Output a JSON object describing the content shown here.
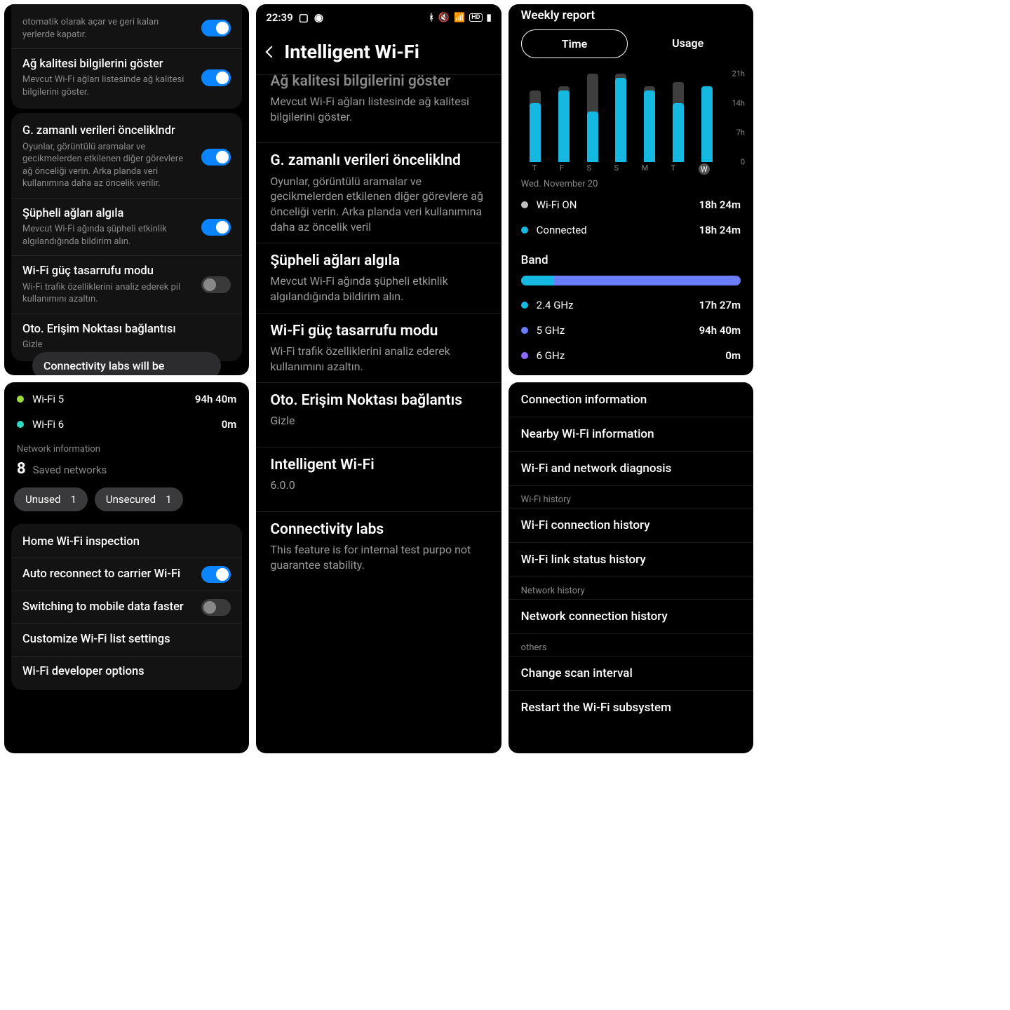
{
  "panel1": {
    "items": [
      {
        "title": "",
        "sub": "otomatik olarak açar ve geri kalan yerlerde kapatır.",
        "toggle": "on"
      },
      {
        "title": "Ağ kalitesi bilgilerini göster",
        "sub": "Mevcut Wi-Fi ağları listesinde ağ kalitesi bilgilerini göster.",
        "toggle": "on"
      },
      {
        "title": "G. zamanlı verileri önceliklndr",
        "sub": "Oyunlar, görüntülü aramalar ve gecikmelerden etkilenen diğer görevlere ağ önceliği verin. Arka planda veri kullanımına daha az öncelik verilir.",
        "toggle": "on"
      },
      {
        "title": "Şüpheli ağları algıla",
        "sub": "Mevcut Wi-Fi ağında şüpheli etkinlik algılandığında bildirim alın.",
        "toggle": "on"
      },
      {
        "title": "Wi-Fi güç tasarrufu modu",
        "sub": "Wi-Fi trafik özelliklerini analiz ederek pil kullanımını azaltın.",
        "toggle": "off"
      },
      {
        "title": "Oto. Erişim Noktası bağlantısı",
        "sub": "Gizle"
      }
    ],
    "overlay": "Connectivity labs will be"
  },
  "panel2": {
    "time": "22:39",
    "hdTitle": "Intelligent Wi-Fi",
    "items": [
      {
        "t": "Ağ kalitesi bilgilerini göster",
        "s": "Mevcut Wi-Fi ağları listesinde ağ kalitesi bilgilerini göster."
      },
      {
        "t": "G. zamanlı verileri önceliklnd",
        "s": "Oyunlar, görüntülü aramalar ve gecikmelerden etkilenen diğer görevlere ağ önceliği verin. Arka planda veri kullanımına daha az öncelik veril"
      },
      {
        "t": "Şüpheli ağları algıla",
        "s": "Mevcut Wi-Fi ağında şüpheli etkinlik algılandığında bildirim alın."
      },
      {
        "t": "Wi-Fi güç tasarrufu modu",
        "s": "Wi-Fi trafik özelliklerini analiz ederek kullanımını azaltın."
      },
      {
        "t": "Oto. Erişim Noktası bağlantıs",
        "s": "Gizle"
      },
      {
        "t": "Intelligent Wi-Fi",
        "s": "6.0.0"
      },
      {
        "t": "Connectivity labs",
        "s": "This feature is for internal test purpo not guarantee stability."
      }
    ]
  },
  "panel3": {
    "wifiVersions": [
      {
        "color": "#9bdc3f",
        "label": "Wi-Fi 5",
        "value": "94h 40m"
      },
      {
        "color": "#2fd9c4",
        "label": "Wi-Fi 6",
        "value": "0m"
      }
    ],
    "netInfoLabel": "Network information",
    "savedCount": "8",
    "savedLabel": "Saved networks",
    "chips": [
      {
        "label": "Unused",
        "count": "1"
      },
      {
        "label": "Unsecured",
        "count": "1"
      }
    ],
    "links": [
      {
        "title": "Home Wi-Fi inspection"
      },
      {
        "title": "Auto reconnect to carrier Wi-Fi",
        "toggle": "on"
      },
      {
        "title": "Switching to mobile data faster",
        "toggle": "off"
      },
      {
        "title": "Customize Wi-Fi list settings"
      },
      {
        "title": "Wi-Fi developer options"
      }
    ]
  },
  "panel4": {
    "title": "Weekly report",
    "tabs": {
      "active": "Time",
      "other": "Usage"
    },
    "dateLabel": "Wed. November 20",
    "legend": [
      {
        "color": "#bfbfbf",
        "label": "Wi-Fi ON",
        "value": "18h 24m"
      },
      {
        "color": "#14b8e0",
        "label": "Connected",
        "value": "18h 24m"
      }
    ],
    "bandTitle": "Band",
    "band": [
      {
        "color": "#14b8e0",
        "label": "2.4 GHz",
        "value": "17h 27m"
      },
      {
        "color": "#6b7dff",
        "label": "5 GHz",
        "value": "94h 40m"
      },
      {
        "color": "#8a6bff",
        "label": "6 GHz",
        "value": "0m"
      }
    ],
    "bandSplitPct": 15
  },
  "panel5": {
    "top": [
      "Connection information",
      "Nearby Wi-Fi information",
      "Wi-Fi and network diagnosis"
    ],
    "h1": "Wi-Fi history",
    "g1": [
      "Wi-Fi connection history",
      "Wi-Fi link status history"
    ],
    "h2": "Network history",
    "g2": [
      "Network connection history"
    ],
    "h3": "others",
    "g3": [
      "Change scan interval",
      "Restart the Wi-Fi subsystem"
    ]
  },
  "chart_data": {
    "type": "bar",
    "title": "Weekly report — Time",
    "ylabel": "hours",
    "ylim": [
      0,
      21
    ],
    "yticks": [
      0,
      7,
      14,
      21
    ],
    "categories": [
      "T",
      "F",
      "S",
      "S",
      "M",
      "T",
      "W"
    ],
    "series": [
      {
        "name": "Wi-Fi ON",
        "values": [
          17,
          18,
          21,
          21,
          18,
          19,
          18
        ]
      },
      {
        "name": "Connected",
        "values": [
          14,
          17,
          12,
          20,
          17,
          14,
          18
        ]
      }
    ]
  }
}
